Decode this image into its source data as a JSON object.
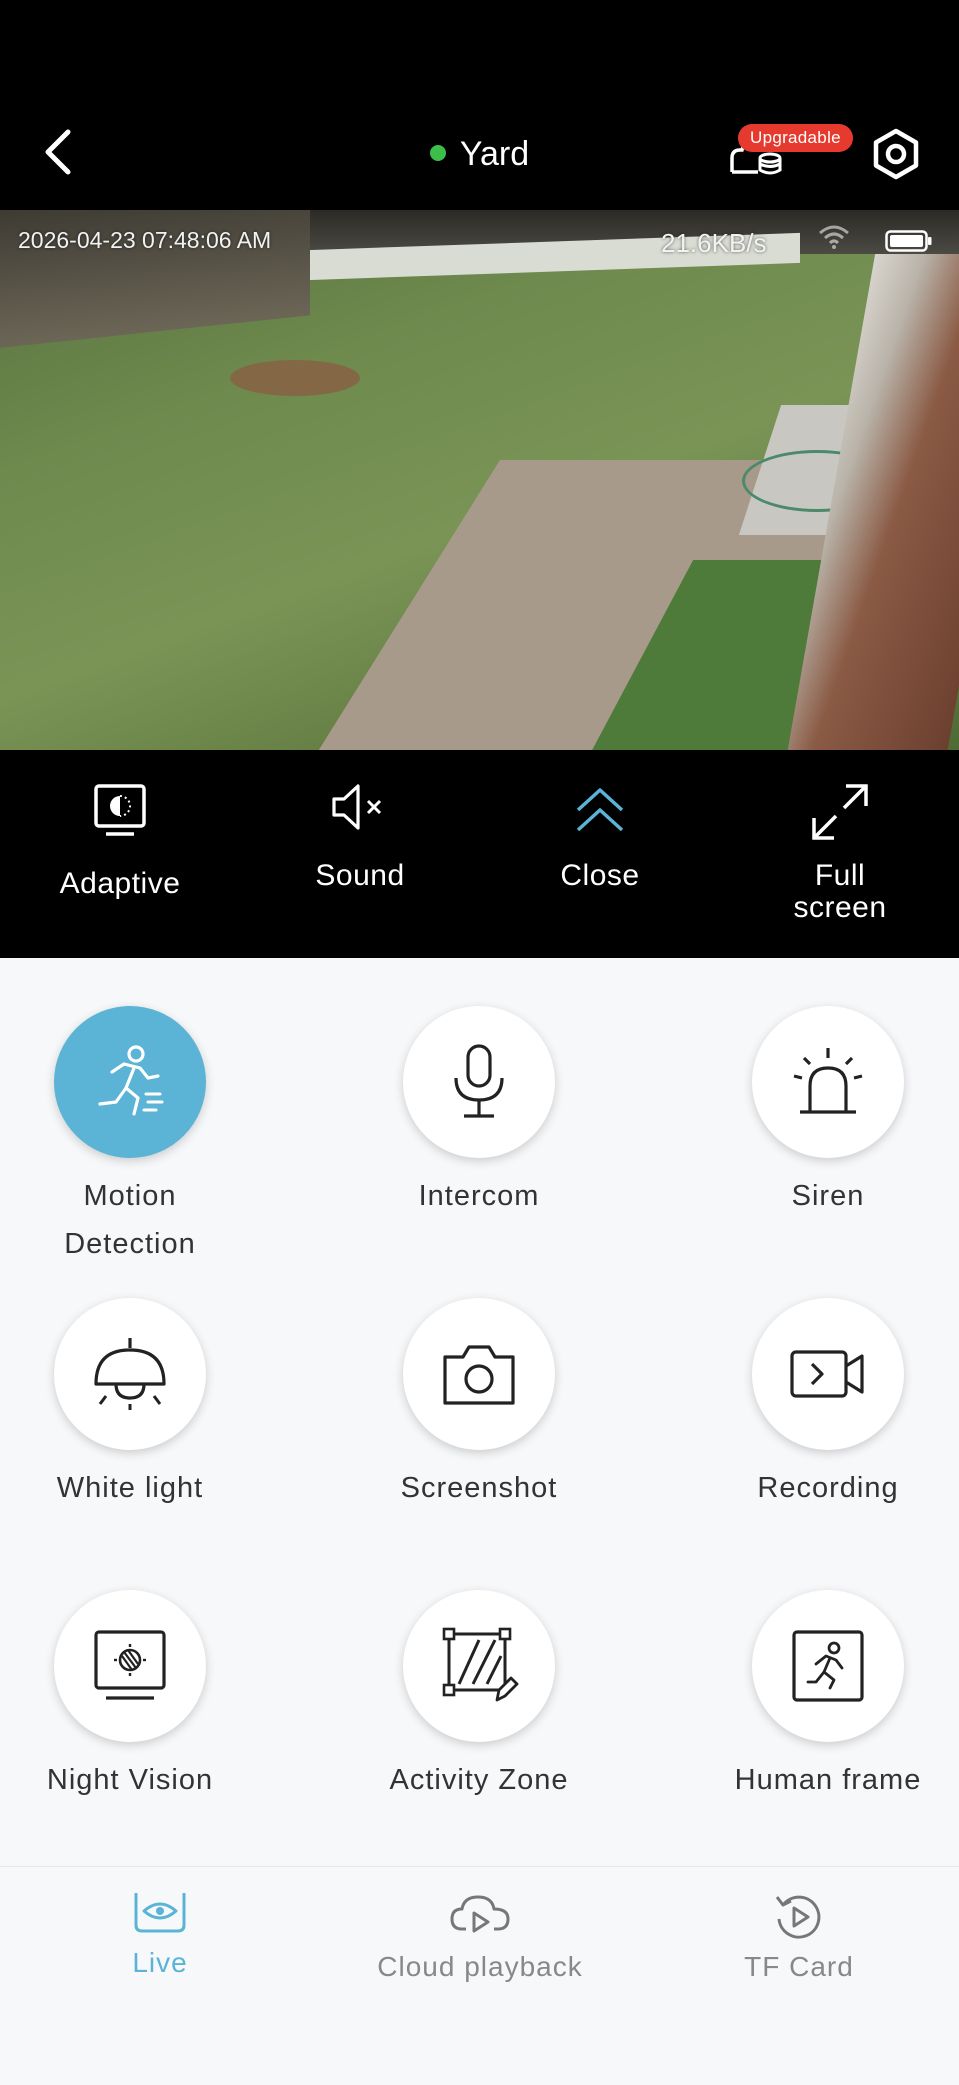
{
  "header": {
    "title": "Yard",
    "status_color": "#3bbf4a",
    "badge": "Upgradable",
    "back_icon": "chevron-left-icon",
    "cloud_icon": "cloud-storage-icon",
    "settings_icon": "hexagon-settings-icon"
  },
  "video": {
    "timestamp": "2026-04-23 07:48:06 AM",
    "bitrate": "21.6KB/s",
    "wifi_icon": "wifi-icon",
    "battery_icon": "battery-full-icon"
  },
  "controls": [
    {
      "label": "Adaptive",
      "icon": "adaptive-display-icon"
    },
    {
      "label": "Sound",
      "icon": "speaker-muted-icon"
    },
    {
      "label": "Close",
      "icon": "double-chevron-up-icon",
      "color": "#5bb3d5"
    },
    {
      "label": "Full\nscreen",
      "icon": "expand-icon"
    }
  ],
  "features": [
    {
      "label": "Motion\nDetection",
      "icon": "running-person-icon",
      "active": true
    },
    {
      "label": "Intercom",
      "icon": "microphone-icon",
      "active": false
    },
    {
      "label": "Siren",
      "icon": "siren-icon",
      "active": false
    },
    {
      "label": "White light",
      "icon": "ceiling-lamp-icon",
      "active": false
    },
    {
      "label": "Screenshot",
      "icon": "camera-icon",
      "active": false
    },
    {
      "label": "Recording",
      "icon": "video-record-icon",
      "active": false
    },
    {
      "label": "Night Vision",
      "icon": "night-vision-icon",
      "active": false
    },
    {
      "label": "Activity Zone",
      "icon": "activity-zone-icon",
      "active": false
    },
    {
      "label": "Human frame",
      "icon": "human-frame-icon",
      "active": false
    }
  ],
  "tabs": [
    {
      "label": "Live",
      "icon": "live-eye-icon",
      "active": true
    },
    {
      "label": "Cloud playback",
      "icon": "cloud-play-icon",
      "active": false
    },
    {
      "label": "TF Card",
      "icon": "replay-icon",
      "active": false
    }
  ],
  "colors": {
    "accent": "#5bb3d5",
    "badge": "#e63a2e",
    "background": "#f7f8fa"
  }
}
